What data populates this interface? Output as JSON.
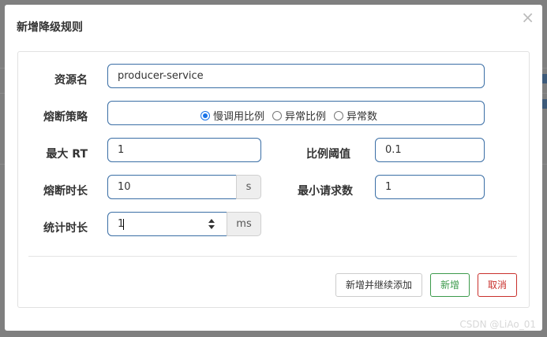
{
  "dialog": {
    "title": "新增降级规则",
    "close_icon": "×"
  },
  "form": {
    "resource_name": {
      "label": "资源名",
      "value": "producer-service"
    },
    "strategy": {
      "label": "熔断策略",
      "options": [
        {
          "label": "慢调用比例",
          "checked": true
        },
        {
          "label": "异常比例",
          "checked": false
        },
        {
          "label": "异常数",
          "checked": false
        }
      ]
    },
    "max_rt": {
      "label": "最大 RT",
      "value": "1"
    },
    "ratio_threshold": {
      "label": "比例阈值",
      "value": "0.1"
    },
    "break_duration": {
      "label": "熔断时长",
      "value": "10",
      "unit": "s"
    },
    "min_requests": {
      "label": "最小请求数",
      "value": "1"
    },
    "stat_duration": {
      "label": "统计时长",
      "value": "1",
      "unit": "ms"
    }
  },
  "footer": {
    "save_continue_label": "新增并继续添加",
    "add_label": "新增",
    "cancel_label": "取消"
  },
  "watermark": "CSDN @LiAo_01",
  "colors": {
    "input_border": "#3a6ea5",
    "success": "#3c9a4b",
    "danger": "#c9302c",
    "radio": "#1a73e8"
  }
}
